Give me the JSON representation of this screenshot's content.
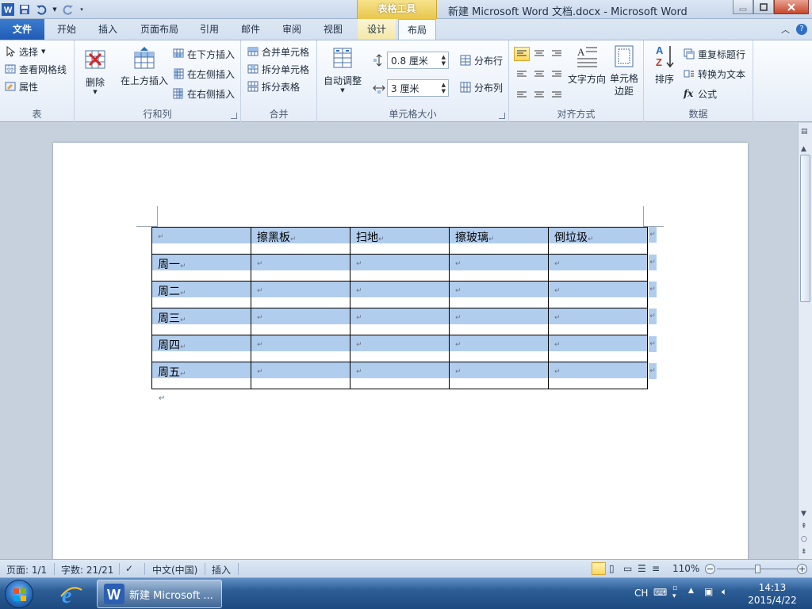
{
  "window": {
    "title": "新建 Microsoft Word 文档.docx - Microsoft Word",
    "context_group": "表格工具",
    "app_icon": "W"
  },
  "tabs": [
    {
      "label": "文件"
    },
    {
      "label": "开始"
    },
    {
      "label": "插入"
    },
    {
      "label": "页面布局"
    },
    {
      "label": "引用"
    },
    {
      "label": "邮件"
    },
    {
      "label": "审阅"
    },
    {
      "label": "视图"
    },
    {
      "label": "设计"
    },
    {
      "label": "布局"
    }
  ],
  "ribbon": {
    "table": {
      "label": "表",
      "select": "选择",
      "gridlines": "查看网格线",
      "properties": "属性"
    },
    "rows_cols": {
      "label": "行和列",
      "delete": "删除",
      "insert_above": "在上方插入",
      "insert_below": "在下方插入",
      "insert_left": "在左侧插入",
      "insert_right": "在右侧插入"
    },
    "merge": {
      "label": "合并",
      "merge_cells": "合并单元格",
      "split_cells": "拆分单元格",
      "split_table": "拆分表格"
    },
    "cell_size": {
      "label": "单元格大小",
      "autofit": "自动调整",
      "height": "0.8 厘米",
      "width": "3 厘米",
      "dist_rows": "分布行",
      "dist_cols": "分布列"
    },
    "alignment": {
      "label": "对齐方式",
      "text_direction": "文字方向",
      "cell_margins": "单元格边距"
    },
    "data": {
      "label": "数据",
      "sort": "排序",
      "repeat_header": "重复标题行",
      "convert": "转换为文本",
      "formula": "公式"
    }
  },
  "document": {
    "table": {
      "header": [
        "",
        "擦黑板",
        "扫地",
        "擦玻璃",
        "倒垃圾"
      ],
      "rows": [
        [
          "周一",
          "",
          "",
          "",
          ""
        ],
        [
          "周二",
          "",
          "",
          "",
          ""
        ],
        [
          "周三",
          "",
          "",
          "",
          ""
        ],
        [
          "周四",
          "",
          "",
          "",
          ""
        ],
        [
          "周五",
          "",
          "",
          "",
          ""
        ]
      ]
    },
    "para_mark": "↵"
  },
  "status": {
    "page": "页面: 1/1",
    "words": "字数: 21/21",
    "language": "中文(中国)",
    "mode": "插入",
    "zoom": "110%"
  },
  "taskbar": {
    "word_task": "新建 Microsoft ...",
    "ime": "CH",
    "time": "14:13",
    "date": "2015/4/22"
  }
}
